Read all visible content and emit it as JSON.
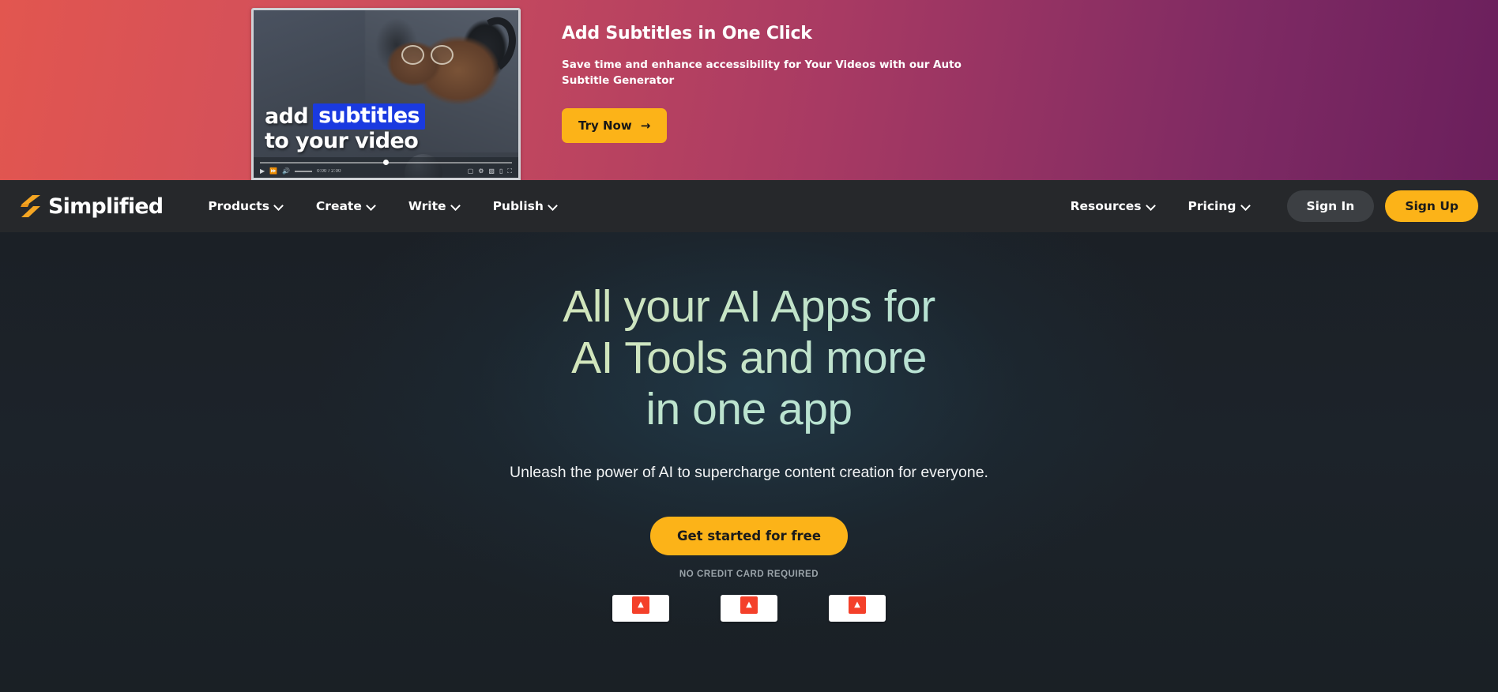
{
  "promo": {
    "thumbnail": {
      "caption_line1_plain": "add",
      "caption_line1_highlight": "subtitles",
      "caption_line2": "to your video",
      "time": "0:00 / 2:00",
      "icon_play": "play-icon",
      "icon_next": "next-icon",
      "icon_volume": "volume-icon",
      "icon_subtitles": "subtitles-icon",
      "icon_settings": "settings-icon",
      "icon_miniplayer": "miniplayer-icon",
      "icon_theater": "theater-icon",
      "icon_fullscreen": "fullscreen-icon"
    },
    "title": "Add Subtitles in One Click",
    "subtitle": "Save time and enhance accessibility for Your Videos with our Auto Subtitle Generator",
    "cta_label": "Try Now",
    "cta_arrow": "→",
    "gradient_from": "#e2564f",
    "gradient_to": "#6a1f5c"
  },
  "navbar": {
    "brand": "Simplified",
    "brand_mark_color": "#f5a623",
    "left_items": [
      {
        "label": "Products",
        "caret": "chevron-down"
      },
      {
        "label": "Create",
        "caret": "chevron-down"
      },
      {
        "label": "Write",
        "caret": "chevron-down"
      },
      {
        "label": "Publish",
        "caret": "chevron-down"
      }
    ],
    "right_items": [
      {
        "label": "Resources",
        "caret": "chevron-down"
      },
      {
        "label": "Pricing",
        "caret": "chevron-down"
      }
    ],
    "sign_in": "Sign In",
    "sign_up": "Sign Up",
    "background": "#26282b",
    "accent": "#fcb318"
  },
  "hero": {
    "heading_line1": "All your AI Apps for",
    "heading_line2": "AI Tools and more",
    "heading_line3": "in one app",
    "subheading": "Unleash the power of AI to supercharge content creation for everyone.",
    "cta_label": "Get started for free",
    "note": "NO CREDIT CARD REQUIRED",
    "gradient_text_from": "#ece4a4",
    "gradient_text_to": "#a8dfe2",
    "badges": [
      {
        "mark": "review-badge-1",
        "chip": "▲"
      },
      {
        "mark": "review-badge-2",
        "chip": "▲"
      },
      {
        "mark": "review-badge-3",
        "chip": "▲"
      }
    ]
  }
}
